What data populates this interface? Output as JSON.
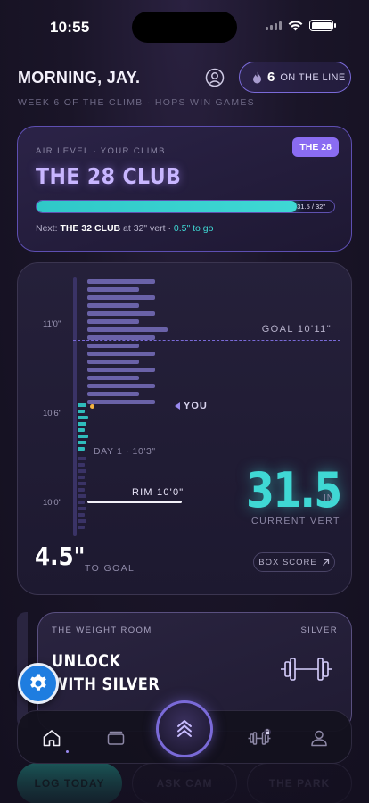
{
  "status_bar": {
    "time": "10:55"
  },
  "header": {
    "greeting": "MORNING, JAY.",
    "subline": "WEEK 6 OF THE CLIMB · HOPS WIN GAMES",
    "streak_count": "6",
    "streak_label": "ON THE LINE"
  },
  "level_card": {
    "caption": "AIR LEVEL · YOUR CLIMB",
    "title": "THE 28 CLUB",
    "badge": "THE 28",
    "progress_fraction": 0.875,
    "progress_text": "31.5 / 32\"",
    "next_prefix": "Next: ",
    "next_level": "THE 32 CLUB",
    "next_mid": " at 32\" vert · ",
    "next_remaining": "0.5\" to go"
  },
  "climb_card": {
    "y_ticks": [
      "11'0\"",
      "10'6\"",
      "10'0\""
    ],
    "goal_label": "GOAL 10'11\"",
    "you_label": "YOU",
    "day1_label": "DAY 1 · 10'3\"",
    "rim_label": "RIM 10'0\"",
    "current_vert": "31.5",
    "current_vert_unit": "IN",
    "current_vert_caption": "CURRENT VERT",
    "to_goal_value": "4.5\"",
    "to_goal_label": "TO GOAL",
    "box_score_label": "BOX SCORE"
  },
  "weight_room": {
    "caption": "THE WEIGHT ROOM",
    "tier": "SILVER",
    "title_line1": "UNLOCK",
    "title_line2": "WITH SILVER"
  },
  "tab_bar": {
    "tabs": [
      "home-icon",
      "cards-icon",
      "hops-icon",
      "dumbbell-locked-icon",
      "profile-icon"
    ],
    "active": "home-icon"
  },
  "quick_actions": [
    "LOG TODAY",
    "ASK CAM",
    "THE PARK"
  ],
  "colors": {
    "accent_purple": "#7a6ad8",
    "accent_teal": "#3fd8d4",
    "background": "#1a1528",
    "fab_blue": "#1e7de0"
  }
}
